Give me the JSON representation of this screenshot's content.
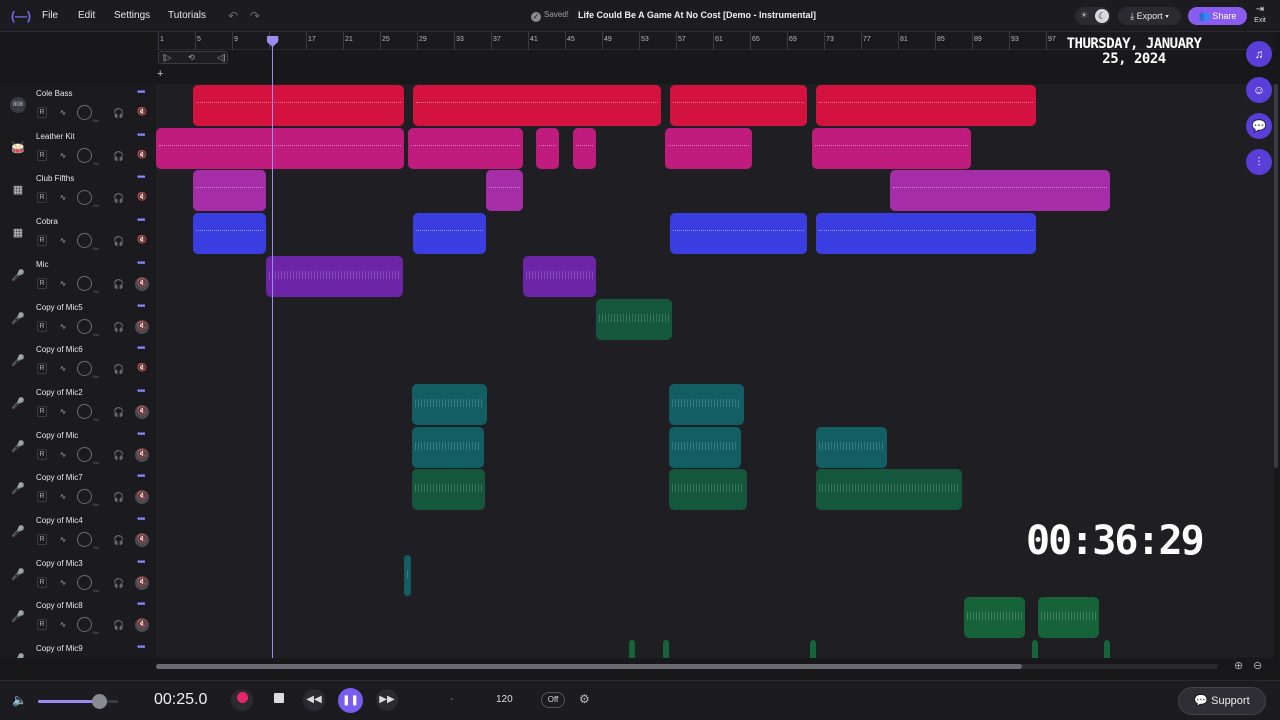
{
  "topbar": {
    "logo": "(—)",
    "menu": [
      "File",
      "Edit",
      "Settings",
      "Tutorials"
    ],
    "undo_icon": "undo-icon",
    "redo_icon": "redo-icon",
    "saved_label": "Saved!",
    "song_title": "Life Could Be A Game At No Cost [Demo - Instrumental]",
    "export_label": "Export",
    "share_label": "Share",
    "exit_label": "Exit"
  },
  "ruler": {
    "labels": [
      "1",
      "5",
      "9",
      "13",
      "17",
      "21",
      "25",
      "29",
      "33",
      "37",
      "41",
      "45",
      "49",
      "53",
      "57",
      "61",
      "65",
      "69",
      "73",
      "77",
      "81",
      "85",
      "89",
      "93",
      "97"
    ]
  },
  "playhead": {
    "position_seconds": 25.0
  },
  "tracks": [
    {
      "name": "Cole Bass",
      "icon": "808",
      "mute": false,
      "color": "#d4123f"
    },
    {
      "name": "Leather Kit",
      "icon": "drum-icon",
      "mute": false,
      "color": "#c01c7e"
    },
    {
      "name": "Club Fifths",
      "icon": "keyboard-icon",
      "mute": false,
      "color": "#a52ea8"
    },
    {
      "name": "Cobra",
      "icon": "keyboard-icon",
      "mute": false,
      "color": "#3a3ee0"
    },
    {
      "name": "Mic",
      "icon": "mic-icon",
      "mute": true,
      "color": "#6d25a8"
    },
    {
      "name": "Copy of Mic5",
      "icon": "mic-icon",
      "mute": true,
      "color": "#15573d"
    },
    {
      "name": "Copy of Mic6",
      "icon": "mic-icon",
      "mute": false,
      "color": "#15573d"
    },
    {
      "name": "Copy of Mic2",
      "icon": "mic-icon",
      "mute": true,
      "color": "#125e63"
    },
    {
      "name": "Copy of Mic",
      "icon": "mic-icon",
      "mute": true,
      "color": "#125e63"
    },
    {
      "name": "Copy of Mic7",
      "icon": "mic-icon",
      "mute": true,
      "color": "#15573d"
    },
    {
      "name": "Copy of Mic4",
      "icon": "mic-icon",
      "mute": true,
      "color": "#15573d"
    },
    {
      "name": "Copy of Mic3",
      "icon": "mic-icon",
      "mute": true,
      "color": "#125e63"
    },
    {
      "name": "Copy of Mic8",
      "icon": "mic-icon",
      "mute": true,
      "color": "#16633a"
    },
    {
      "name": "Copy of Mic9",
      "icon": "mic-icon",
      "mute": false,
      "color": "#16633a"
    }
  ],
  "track_controls": {
    "record": "R",
    "volume_knob_label": "Vol"
  },
  "overlay": {
    "date": "THURSDAY, JANUARY 25, 2024",
    "timer": "00:36:29"
  },
  "sidebar": [
    "music-note-icon",
    "collab-icon",
    "chat-icon",
    "mixer-icon"
  ],
  "transport": {
    "volume_level": 0.76,
    "time": "00:25.0",
    "key": "-",
    "bpm": "120",
    "metronome": "Off",
    "support_label": "Support"
  }
}
